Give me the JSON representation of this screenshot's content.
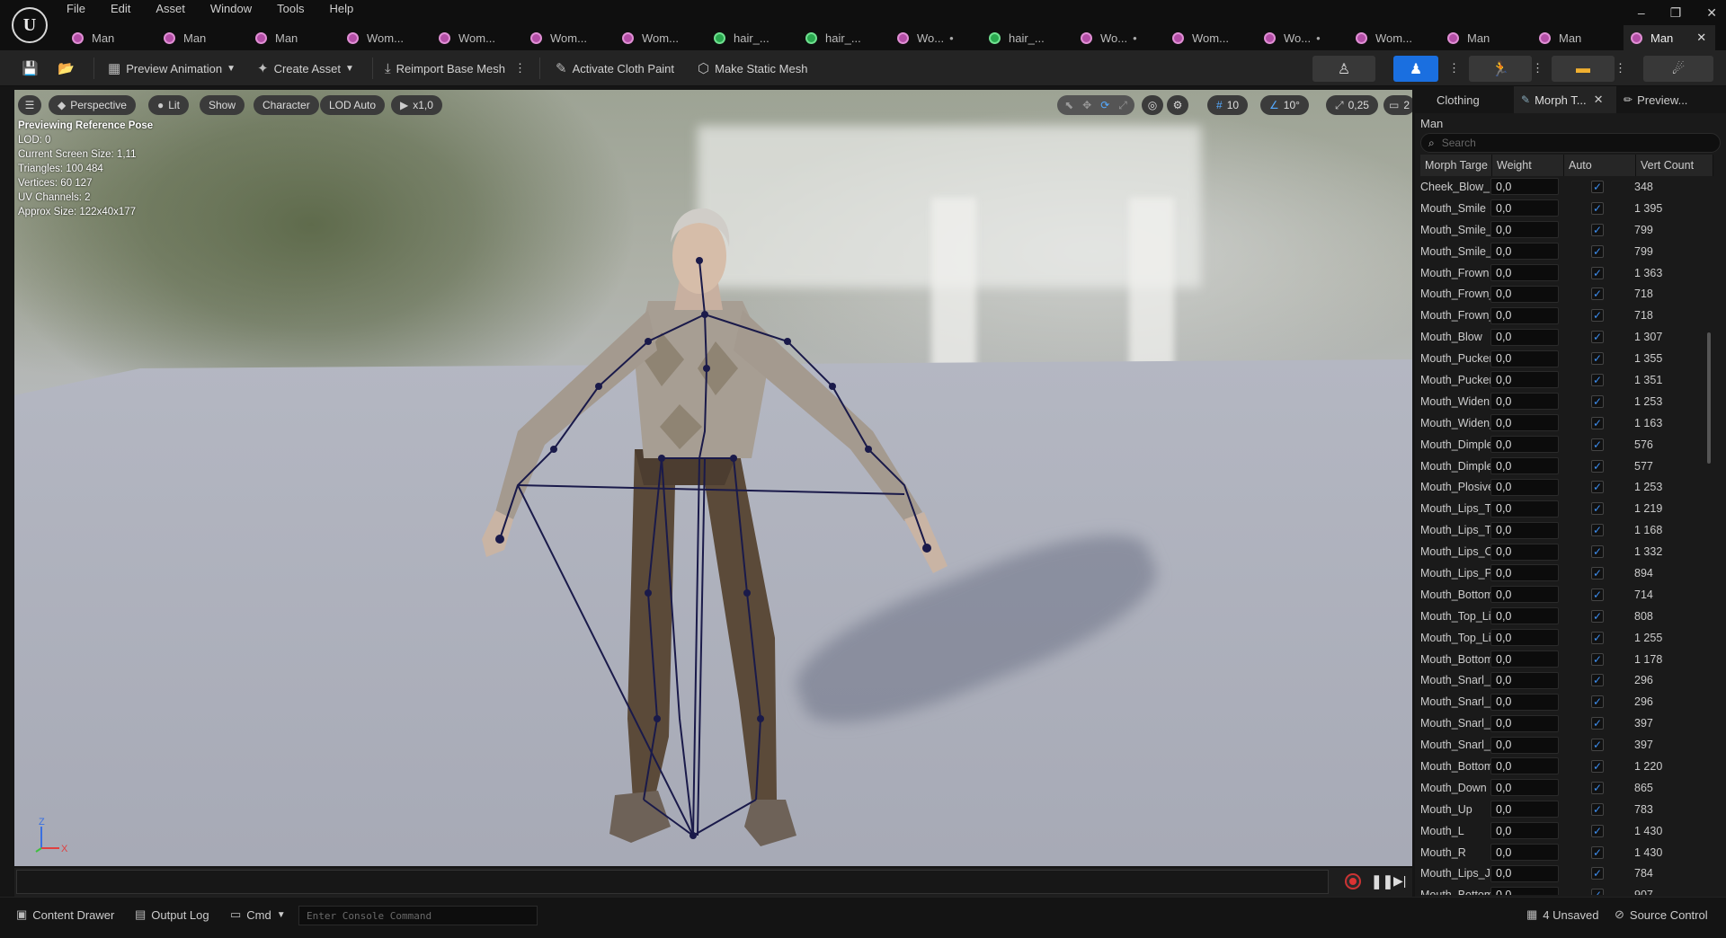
{
  "menu": [
    "File",
    "Edit",
    "Asset",
    "Window",
    "Tools",
    "Help"
  ],
  "window_controls": {
    "minimize": "–",
    "restore": "❐",
    "close": "✕"
  },
  "tabs": [
    {
      "label": "Man",
      "icon": "mesh-icon",
      "kind": "m"
    },
    {
      "label": "Man",
      "icon": "mesh-icon",
      "kind": "m"
    },
    {
      "label": "Man",
      "icon": "mesh-icon",
      "kind": "m"
    },
    {
      "label": "Wom...",
      "icon": "mesh-icon",
      "kind": "m"
    },
    {
      "label": "Wom...",
      "icon": "mesh-icon",
      "kind": "m"
    },
    {
      "label": "Wom...",
      "icon": "mesh-icon",
      "kind": "m"
    },
    {
      "label": "Wom...",
      "icon": "mesh-icon",
      "kind": "m"
    },
    {
      "label": "hair_...",
      "icon": "groom-icon",
      "kind": "h"
    },
    {
      "label": "hair_...",
      "icon": "groom-icon",
      "kind": "h"
    },
    {
      "label": "Wo...",
      "icon": "mesh-icon",
      "kind": "m",
      "dirty": "•"
    },
    {
      "label": "hair_...",
      "icon": "groom-icon",
      "kind": "h"
    },
    {
      "label": "Wo...",
      "icon": "mesh-icon",
      "kind": "m",
      "dirty": "•"
    },
    {
      "label": "Wom...",
      "icon": "mesh-icon",
      "kind": "m"
    },
    {
      "label": "Wo...",
      "icon": "mesh-icon",
      "kind": "m",
      "dirty": "•"
    },
    {
      "label": "Wom...",
      "icon": "mesh-icon",
      "kind": "m"
    },
    {
      "label": "Man",
      "icon": "mesh-icon",
      "kind": "m"
    },
    {
      "label": "Man",
      "icon": "mesh-icon",
      "kind": "m"
    }
  ],
  "active_tab": {
    "label": "Man",
    "close": "✕"
  },
  "toolbar": {
    "preview_animation": "Preview Animation",
    "create_asset": "Create Asset",
    "reimport": "Reimport Base Mesh",
    "cloth_paint": "Activate Cloth Paint",
    "static_mesh": "Make Static Mesh"
  },
  "viewport": {
    "perspective": "Perspective",
    "lit": "Lit",
    "show": "Show",
    "character": "Character",
    "lod": "LOD Auto",
    "speed": "x1,0",
    "grid_snap": "10",
    "rot_snap": "10°",
    "scale_snap": "0,25",
    "camera_speed": "2",
    "stats": [
      "Previewing Reference Pose",
      "LOD: 0",
      "Current Screen Size: 1,11",
      "Triangles: 100 484",
      "Vertices: 60 127",
      "UV Channels: 2",
      "Approx Size: 122x40x177"
    ],
    "axis_z": "Z",
    "axis_x": "X"
  },
  "panel": {
    "tabs": [
      "Clothing",
      "Morph T...",
      "Preview..."
    ],
    "tab_close": "✕",
    "mesh_name": "Man",
    "search_placeholder": "Search",
    "columns": [
      "Morph Targe",
      "Weight",
      "Auto",
      "Vert Count"
    ],
    "check": "✓",
    "rows": [
      {
        "name": "Cheek_Blow_R",
        "weight": "0,0",
        "verts": "348"
      },
      {
        "name": "Mouth_Smile",
        "weight": "0,0",
        "verts": "1 395"
      },
      {
        "name": "Mouth_Smile_L",
        "weight": "0,0",
        "verts": "799"
      },
      {
        "name": "Mouth_Smile_R",
        "weight": "0,0",
        "verts": "799"
      },
      {
        "name": "Mouth_Frown",
        "weight": "0,0",
        "verts": "1 363"
      },
      {
        "name": "Mouth_Frown_L",
        "weight": "0,0",
        "verts": "718"
      },
      {
        "name": "Mouth_Frown_R",
        "weight": "0,0",
        "verts": "718"
      },
      {
        "name": "Mouth_Blow",
        "weight": "0,0",
        "verts": "1 307"
      },
      {
        "name": "Mouth_Pucker",
        "weight": "0,0",
        "verts": "1 355"
      },
      {
        "name": "Mouth_Pucker_Open",
        "weight": "0,0",
        "verts": "1 351"
      },
      {
        "name": "Mouth_Widen",
        "weight": "0,0",
        "verts": "1 253"
      },
      {
        "name": "Mouth_Widen_Sides",
        "weight": "0,0",
        "verts": "1 163"
      },
      {
        "name": "Mouth_Dimple_L",
        "weight": "0,0",
        "verts": "576"
      },
      {
        "name": "Mouth_Dimple_R",
        "weight": "0,0",
        "verts": "577"
      },
      {
        "name": "Mouth_Plosive",
        "weight": "0,0",
        "verts": "1 253"
      },
      {
        "name": "Mouth_Lips_Tight",
        "weight": "0,0",
        "verts": "1 219"
      },
      {
        "name": "Mouth_Lips_Tuck",
        "weight": "0,0",
        "verts": "1 168"
      },
      {
        "name": "Mouth_Lips_Open",
        "weight": "0,0",
        "verts": "1 332"
      },
      {
        "name": "Mouth_Lips_Part",
        "weight": "0,0",
        "verts": "894"
      },
      {
        "name": "Mouth_Bottom_Lip_Down",
        "weight": "0,0",
        "verts": "714"
      },
      {
        "name": "Mouth_Top_Lip_Up",
        "weight": "0,0",
        "verts": "808"
      },
      {
        "name": "Mouth_Top_Lip_Under",
        "weight": "0,0",
        "verts": "1 255"
      },
      {
        "name": "Mouth_Bottom_Lip_Under",
        "weight": "0,0",
        "verts": "1 178"
      },
      {
        "name": "Mouth_Snarl_Upper_L",
        "weight": "0,0",
        "verts": "296"
      },
      {
        "name": "Mouth_Snarl_Upper_R",
        "weight": "0,0",
        "verts": "296"
      },
      {
        "name": "Mouth_Snarl_Lower_L",
        "weight": "0,0",
        "verts": "397"
      },
      {
        "name": "Mouth_Snarl_Lower_R",
        "weight": "0,0",
        "verts": "397"
      },
      {
        "name": "Mouth_Bottom_Lip_Bite",
        "weight": "0,0",
        "verts": "1 220"
      },
      {
        "name": "Mouth_Down",
        "weight": "0,0",
        "verts": "865"
      },
      {
        "name": "Mouth_Up",
        "weight": "0,0",
        "verts": "783"
      },
      {
        "name": "Mouth_L",
        "weight": "0,0",
        "verts": "1 430"
      },
      {
        "name": "Mouth_R",
        "weight": "0,0",
        "verts": "1 430"
      },
      {
        "name": "Mouth_Lips_Jaw_Adjust",
        "weight": "0,0",
        "verts": "784"
      },
      {
        "name": "Mouth_Bottom_Lip_Trans",
        "weight": "0,0",
        "verts": "907"
      }
    ]
  },
  "status": {
    "content_drawer": "Content Drawer",
    "output_log": "Output Log",
    "cmd": "Cmd",
    "console_placeholder": "Enter Console Command",
    "unsaved": "4 Unsaved",
    "source_control": "Source Control"
  }
}
